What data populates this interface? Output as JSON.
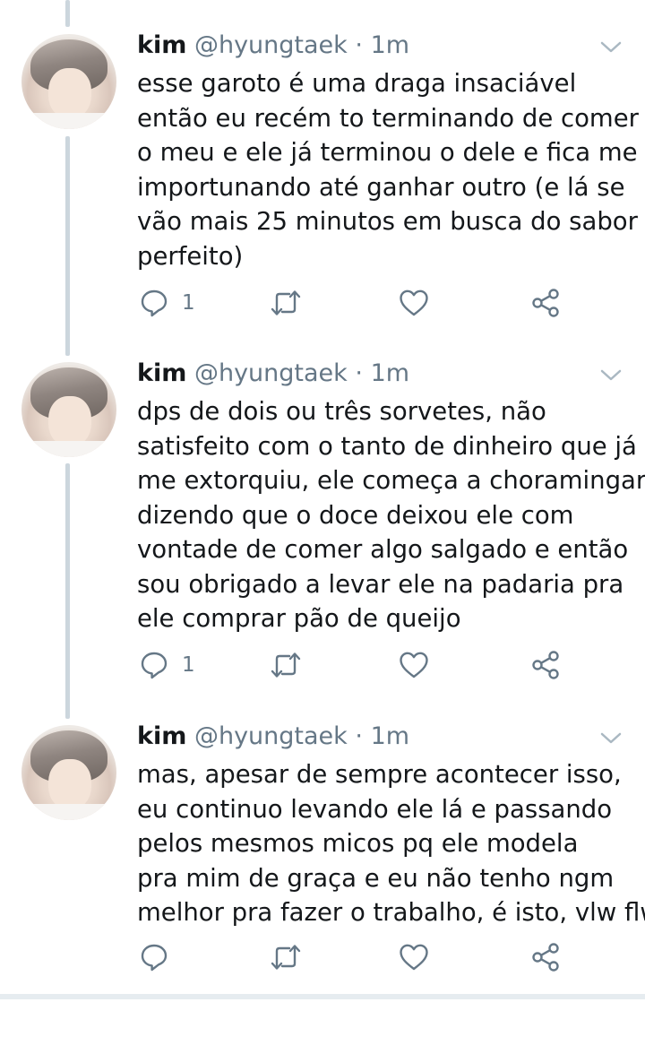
{
  "colors": {
    "text": "#14171a",
    "secondary": "#657786",
    "thread_line": "#ccd6dd"
  },
  "tweets": [
    {
      "name": "kim",
      "handle": "@hyungtaek",
      "dot": "·",
      "time": "1m",
      "lines": [
        "esse garoto é uma draga insaciável",
        "então eu recém to terminando de comer",
        "o meu e ele já terminou o dele e fica me",
        "importunando até ganhar outro (e lá se",
        "vão mais 25 minutos em busca do sabor",
        "perfeito)"
      ],
      "reply_count": "1"
    },
    {
      "name": "kim",
      "handle": "@hyungtaek",
      "dot": "·",
      "time": "1m",
      "lines": [
        "dps de dois ou três sorvetes, não",
        "satisfeito com o tanto de dinheiro que já",
        "me extorquiu, ele começa a choramingar",
        "dizendo que o doce deixou ele com",
        "vontade de comer algo salgado e então",
        "sou obrigado a levar ele na padaria pra",
        "ele comprar pão de queijo"
      ],
      "reply_count": "1"
    },
    {
      "name": "kim",
      "handle": "@hyungtaek",
      "dot": "·",
      "time": "1m",
      "lines": [
        "mas, apesar de sempre acontecer isso,",
        "eu continuo levando ele lá e passando",
        "pelos mesmos micos pq ele modela",
        "pra mim de graça e eu não tenho ngm",
        "melhor pra fazer o trabalho, é isto, vlw flw"
      ],
      "reply_count": ""
    }
  ],
  "icons": {
    "reply": "reply-icon",
    "retweet": "retweet-icon",
    "like": "heart-icon",
    "share": "share-icon",
    "menu": "chevron-down-icon"
  }
}
